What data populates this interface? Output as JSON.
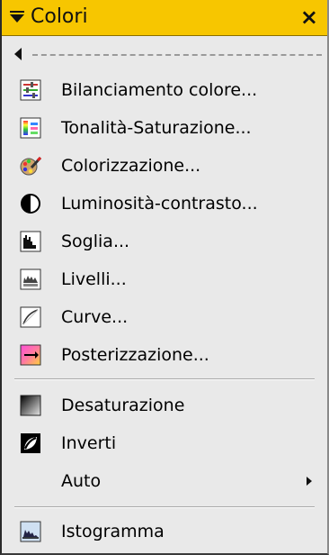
{
  "menu": {
    "title": "Colori",
    "close_glyph": "×",
    "items": [
      {
        "label": "Bilanciamento colore...",
        "icon": "color-balance-icon"
      },
      {
        "label": "Tonalità-Saturazione...",
        "icon": "hue-saturation-icon"
      },
      {
        "label": "Colorizzazione...",
        "icon": "colorize-icon"
      },
      {
        "label": "Luminosità-contrasto...",
        "icon": "brightness-contrast-icon"
      },
      {
        "label": "Soglia...",
        "icon": "threshold-icon"
      },
      {
        "label": "Livelli...",
        "icon": "levels-icon"
      },
      {
        "label": "Curve...",
        "icon": "curves-icon"
      },
      {
        "label": "Posterizzazione...",
        "icon": "posterize-icon"
      },
      {
        "label": "Desaturazione",
        "icon": "desaturate-icon"
      },
      {
        "label": "Inverti",
        "icon": "invert-icon"
      },
      {
        "label": "Auto",
        "icon": ""
      },
      {
        "label": "Istogramma",
        "icon": "histogram-icon"
      }
    ]
  }
}
